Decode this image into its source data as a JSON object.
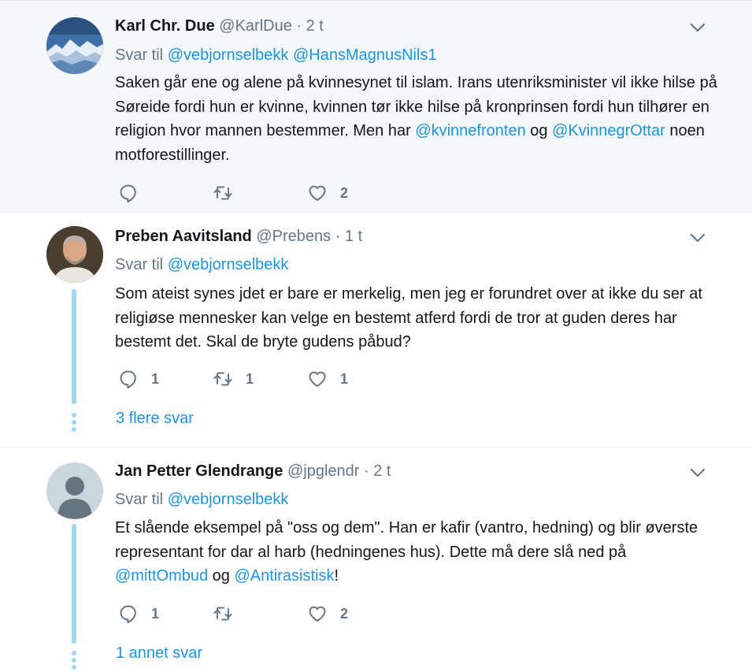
{
  "tweets": [
    {
      "name": "Karl Chr. Due",
      "handle": "@KarlDue",
      "sep": "·",
      "time": "2 t",
      "reply_prefix": "Svar til",
      "reply_to_1": "@vebjornselbekk",
      "reply_to_2": "@HansMagnusNils1",
      "text_1": "Saken går ene og alene på kvinnesynet til islam. Irans utenriksminister vil ikke hilse på Søreide fordi hun er kvinne, kvinnen tør ikke hilse på kronprinsen fordi hun tilhører en religion hvor mannen bestemmer. Men har ",
      "mention_1": "@kvinnefronten",
      "text_2": " og ",
      "mention_2": "@KvinnegrOttar",
      "text_3": " noen motforestillinger.",
      "replies": "",
      "retweets": "",
      "likes": "2"
    },
    {
      "name": "Preben Aavitsland",
      "handle": "@Prebens",
      "sep": "·",
      "time": "1 t",
      "reply_prefix": "Svar til",
      "reply_to_1": "@vebjornselbekk",
      "text_1": "Som ateist synes jdet er bare er merkelig, men jeg er forundret over at ikke du ser at religiøse mennesker kan velge en bestemt atferd fordi de tror at guden deres har bestemt det. Skal de bryte gudens påbud?",
      "replies": "1",
      "retweets": "1",
      "likes": "1",
      "more_replies": "3 flere svar"
    },
    {
      "name": "Jan Petter Glendrange",
      "handle": "@jpglendr",
      "sep": "·",
      "time": "2 t",
      "reply_prefix": "Svar til",
      "reply_to_1": "@vebjornselbekk",
      "text_1": "Et slående eksempel på \"oss og dem\". Han er kafir (vantro, hedning) og blir øverste representant for dar al harb (hedningenes hus). Dette må dere slå ned på ",
      "mention_1": "@mittOmbud",
      "text_2": " og ",
      "mention_2": "@Antirasistisk",
      "text_3": "!",
      "replies": "1",
      "retweets": "",
      "likes": "2",
      "more_replies": "1 annet svar"
    }
  ],
  "icons": {
    "reply": "reply-icon",
    "retweet": "retweet-icon",
    "like": "heart-icon",
    "menu": "chevron-down-icon"
  },
  "colors": {
    "link": "#1b95e0",
    "thread_line": "#9fd6f1",
    "muted": "#657786"
  }
}
